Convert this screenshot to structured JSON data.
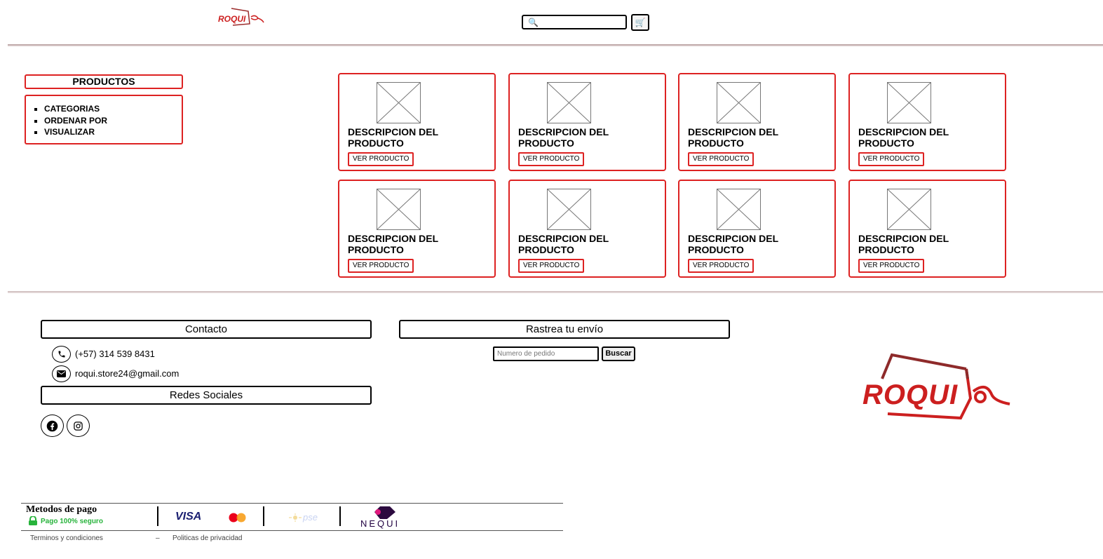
{
  "header": {
    "brand": "ROQUI",
    "search_placeholder": "",
    "cart_icon": "cart-icon",
    "search_icon": "magnifier-icon"
  },
  "sidebar": {
    "title": "PRODUCTOS",
    "items": [
      "CATEGORIAS",
      "ORDENAR POR",
      "VISUALIZAR"
    ]
  },
  "products": [
    {
      "line1": "DESCRIPCION DEL",
      "line2": "PRODUCTO",
      "button": "VER PRODUCTO"
    },
    {
      "line1": "DESCRIPCION DEL",
      "line2": "PRODUCTO",
      "button": "VER PRODUCTO"
    },
    {
      "line1": "DESCRIPCION DEL",
      "line2": "PRODUCTO",
      "button": "VER PRODUCTO"
    },
    {
      "line1": "DESCRIPCION DEL",
      "line2": "PRODUCTO",
      "button": "VER PRODUCTO"
    },
    {
      "line1": "DESCRIPCION DEL",
      "line2": "PRODUCTO",
      "button": "VER PRODUCTO"
    },
    {
      "line1": "DESCRIPCION DEL",
      "line2": "PRODUCTO",
      "button": "VER PRODUCTO"
    },
    {
      "line1": "DESCRIPCION DEL",
      "line2": "PRODUCTO",
      "button": "VER PRODUCTO"
    },
    {
      "line1": "DESCRIPCION DEL",
      "line2": "PRODUCTO",
      "button": "VER PRODUCTO"
    }
  ],
  "footer": {
    "contact_title": "Contacto",
    "phone": "(+57) 314 539 8431",
    "email": "roqui.store24@gmail.com",
    "social_title": "Redes Sociales",
    "social_icons": [
      "facebook-icon",
      "instagram-icon"
    ],
    "track_title": "Rastrea tu envío",
    "track_placeholder": "Numero de pedido",
    "track_button": "Buscar",
    "brand_logo": "ROQUI"
  },
  "payment": {
    "title": "Metodos de pago",
    "secure": "Pago 100% seguro",
    "methods": [
      "VISA",
      "pse",
      "NEQUI"
    ],
    "links": [
      "Terminos y condiciones",
      "–",
      "Politicas de privacidad"
    ]
  },
  "colors": {
    "accent_red": "#dd2222",
    "brand_red": "#cc1f1f",
    "secure_green": "#27b33b"
  }
}
